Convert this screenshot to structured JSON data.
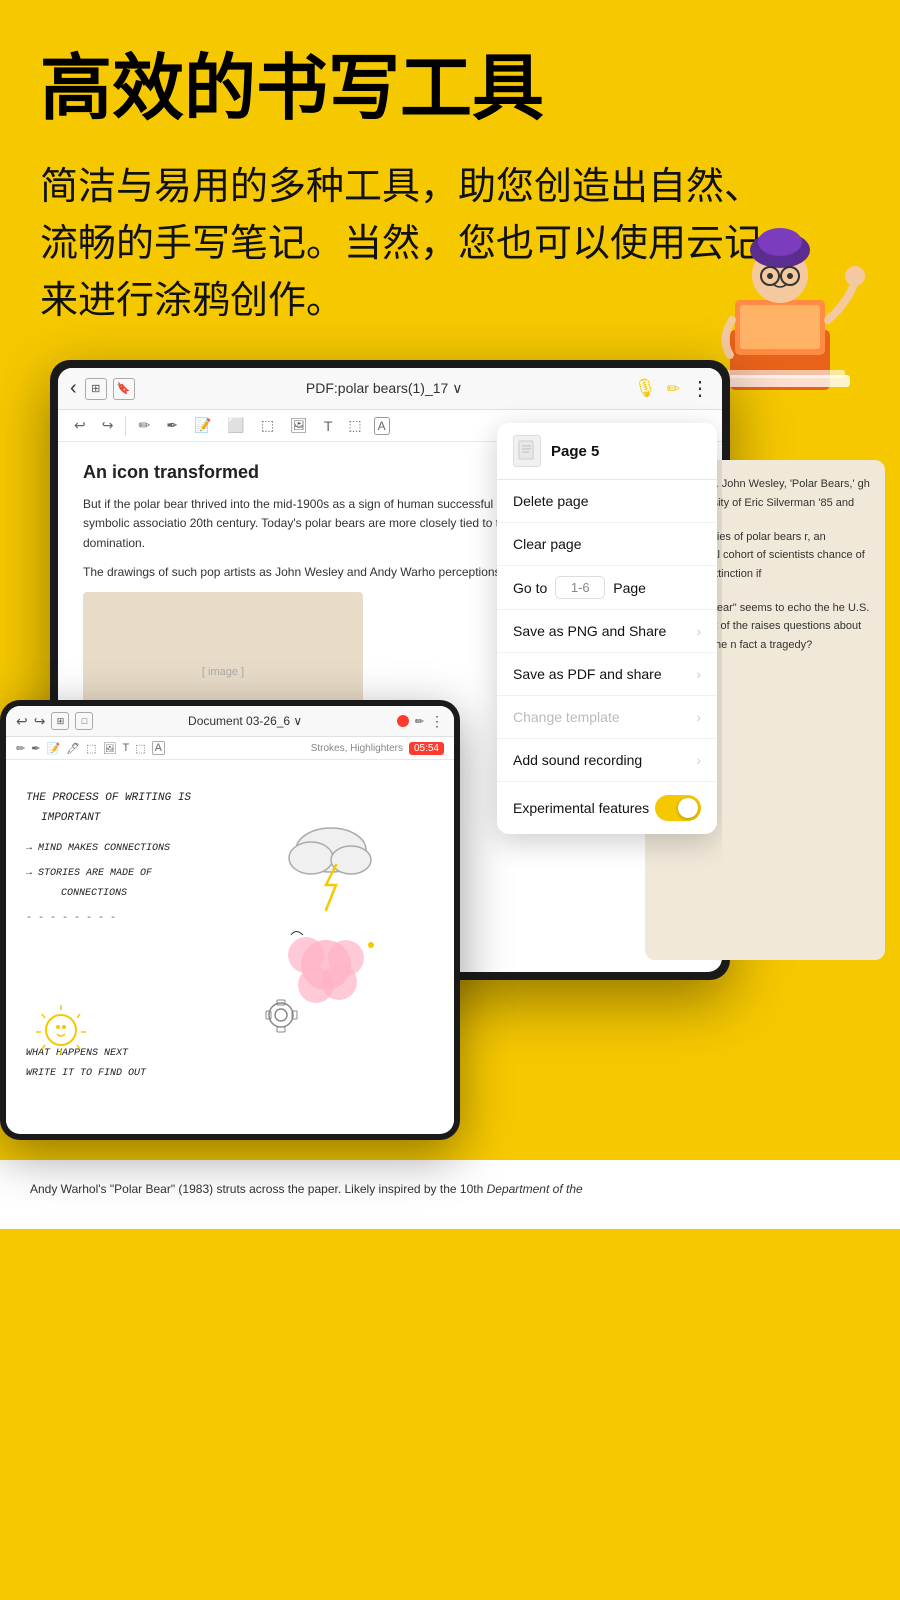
{
  "header": {
    "main_title": "高效的书写工具",
    "subtitle": "简洁与易用的多种工具，助您创造出自然、流畅的手写笔记。当然，您也可以使用云记来进行涂鸦创作。"
  },
  "tablet_main": {
    "title": "PDF:polar bears(1)_17 ∨",
    "back_arrow": "‹",
    "more_icon": "⋮",
    "article_title": "An icon transformed",
    "article_body1": "But if the polar bear thrived into the mid-1900s as a sign of human successful mastery of antagonistic forces, this symbolic associatio 20th century. Today's polar bears are more closely tied to the dem belief in conquest and domination.",
    "article_body2": "The drawings of such pop artists as John Wesley and Andy Warho perceptions."
  },
  "dropdown": {
    "page_label": "Page 5",
    "items": [
      {
        "label": "Delete page",
        "disabled": false,
        "has_chevron": false
      },
      {
        "label": "Clear page",
        "disabled": false,
        "has_chevron": false
      },
      {
        "label": "Go to",
        "type": "goto",
        "placeholder": "1-6",
        "page_suffix": "Page"
      },
      {
        "label": "Save as PNG and Share",
        "disabled": false,
        "has_chevron": true
      },
      {
        "label": "Save as PDF and share",
        "disabled": false,
        "has_chevron": true
      },
      {
        "label": "Change template",
        "disabled": true,
        "has_chevron": true
      },
      {
        "label": "Add sound recording",
        "disabled": false,
        "has_chevron": true
      },
      {
        "label": "Experimental features",
        "type": "toggle",
        "enabled": true
      }
    ]
  },
  "tablet_secondary": {
    "title": "Document 03-26_6 ∨",
    "timer": "05:54",
    "strokes_label": "Strokes, Highlighters",
    "handwriting_lines": [
      "THE PROCESS OF WRITING IS",
      "    IMPORTANT",
      "  → MIND MAKES CONNECTIONS",
      "  → STORIES ARE MADE OF",
      "        CONNECTIONS",
      "  - - - - - - - -"
    ],
    "bottom_lines": [
      "WHAT HAPPENS NEXT",
      "WRITE IT TO FIND OUT"
    ]
  },
  "pdf_side": {
    "text1": "mber mood. John Wesley, 'Polar Bears,' gh the generosity of Eric Silverman '85 and",
    "text2": "rtwined bodies of polar bears r, an international cohort of scientists chance of surviving extinction if",
    "text3": "reat white bear\" seems to echo the he U.S. Department of the raises questions about the fate of the n fact a tragedy?"
  },
  "bottom_caption": {
    "text": "Andy Warhol's \"Polar Bear\" (1983) struts across the paper. Likely inspired by the 10th"
  },
  "colors": {
    "yellow": "#F5C800",
    "dark": "#1a1a1a",
    "white": "#ffffff",
    "toggle_bg": "#F5C800"
  }
}
